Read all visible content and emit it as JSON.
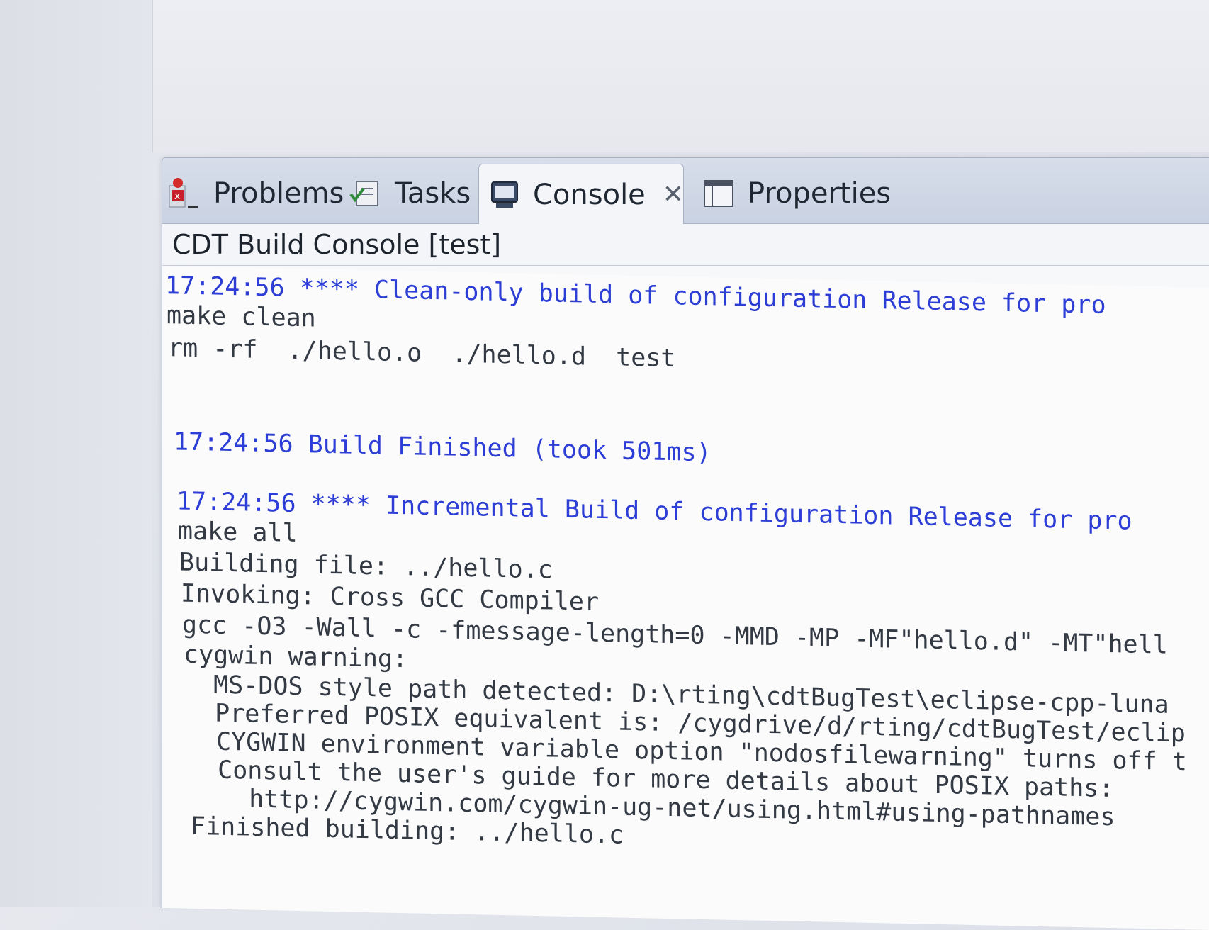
{
  "tabs": [
    {
      "label": "Problems",
      "icon": "problems-icon",
      "active": false
    },
    {
      "label": "Tasks",
      "icon": "tasks-icon",
      "active": false
    },
    {
      "label": "Console",
      "icon": "console-icon",
      "active": true
    },
    {
      "label": "Properties",
      "icon": "properties-icon",
      "active": false
    }
  ],
  "console": {
    "title": "CDT Build Console [test]",
    "lines": [
      "17:24:56 **** Clean-only build of configuration Release for pro",
      "make clean",
      "rm -rf  ./hello.o  ./hello.d  test",
      "17:24:56 Build Finished (took 501ms)",
      "17:24:56 **** Incremental Build of configuration Release for pro",
      "make all",
      "Building file: ../hello.c",
      "Invoking: Cross GCC Compiler",
      "gcc -O3 -Wall -c -fmessage-length=0 -MMD -MP -MF\"hello.d\" -MT\"hell",
      "cygwin warning:",
      "  MS-DOS style path detected: D:\\rting\\cdtBugTest\\eclipse-cpp-luna",
      "  Preferred POSIX equivalent is: /cygdrive/d/rting/cdtBugTest/eclip",
      "  CYGWIN environment variable option \"nodosfilewarning\" turns off t",
      "  Consult the user's guide for more details about POSIX paths:",
      "    http://cygwin.com/cygwin-ug-net/using.html#using-pathnames",
      "Finished building: ../hello.c"
    ]
  },
  "colors": {
    "timestamp_blue": "#2d3ed6",
    "output_gray": "#333a44"
  }
}
